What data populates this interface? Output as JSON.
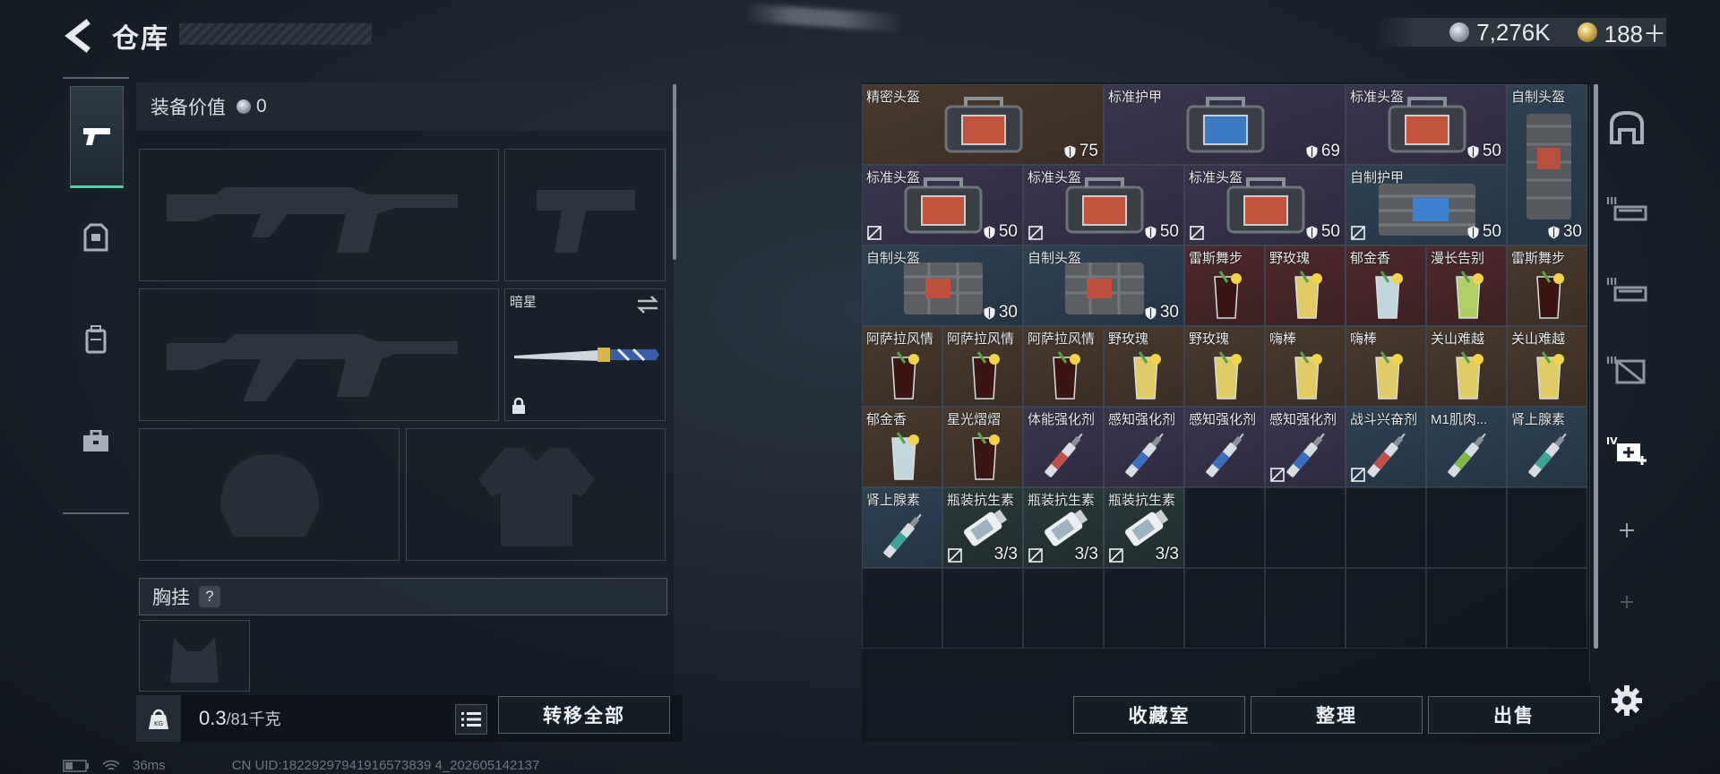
{
  "header": {
    "title": "仓库"
  },
  "currency": {
    "silver": "7,276K",
    "gold": "188＋"
  },
  "equipment": {
    "value_label": "装备价值",
    "value": "0",
    "melee_slot_name": "暗星",
    "chest_label": "胸挂",
    "chest_help": "?"
  },
  "weight": {
    "current": "0.3",
    "max": "/81千克",
    "icon_label": "KG"
  },
  "buttons": {
    "transfer_all": "转移全部",
    "collection": "收藏室",
    "sort": "整理",
    "sell": "出售"
  },
  "status": {
    "ping": "36ms",
    "uid": "CN UID:18229297941916573839 4_202605142137"
  },
  "warehouse_items": [
    {
      "name": "精密头盔",
      "value": "75"
    },
    {
      "name": "标准护甲",
      "value": "69"
    },
    {
      "name": "标准头盔",
      "value": "50"
    },
    {
      "name": "自制头盔",
      "value": "30"
    },
    {
      "name": "标准头盔",
      "value": "50"
    },
    {
      "name": "标准头盔",
      "value": "50"
    },
    {
      "name": "标准头盔",
      "value": "50"
    },
    {
      "name": "自制护甲",
      "value": "50"
    },
    {
      "name": "自制头盔",
      "value": "30"
    },
    {
      "name": "自制头盔",
      "value": "30"
    },
    {
      "name": "雷斯舞步"
    },
    {
      "name": "野玫瑰"
    },
    {
      "name": "郁金香"
    },
    {
      "name": "漫长告别"
    },
    {
      "name": "雷斯舞步"
    },
    {
      "name": "阿萨拉风情"
    },
    {
      "name": "阿萨拉风情"
    },
    {
      "name": "阿萨拉风情"
    },
    {
      "name": "野玫瑰"
    },
    {
      "name": "野玫瑰"
    },
    {
      "name": "嗨棒"
    },
    {
      "name": "嗨棒"
    },
    {
      "name": "关山难越"
    },
    {
      "name": "关山难越"
    },
    {
      "name": "郁金香"
    },
    {
      "name": "星光熠熠"
    },
    {
      "name": "体能强化剂"
    },
    {
      "name": "感知强化剂"
    },
    {
      "name": "感知强化剂"
    },
    {
      "name": "感知强化剂"
    },
    {
      "name": "战斗兴奋剂"
    },
    {
      "name": "M1肌肉..."
    },
    {
      "name": "肾上腺素"
    },
    {
      "name": "肾上腺素"
    },
    {
      "name": "瓶装抗生素",
      "value": "3/3"
    },
    {
      "name": "瓶装抗生素",
      "value": "3/3"
    },
    {
      "name": "瓶装抗生素",
      "value": "3/3"
    }
  ],
  "colors": {
    "accent": "#4fd1a3",
    "rarity_brown": "#4a3a2e",
    "rarity_purple": "#3b3650",
    "rarity_blue": "#2e4254",
    "rarity_red": "#4e2a2c"
  },
  "icons": {
    "back": "back-arrow-icon",
    "tab_weapons": "pistol-icon",
    "tab_armor": "armor-icon",
    "tab_backpack": "backpack-icon",
    "tab_case": "briefcase-icon",
    "weight": "kettlebell-icon",
    "list": "list-icon",
    "settings": "gear-icon"
  }
}
